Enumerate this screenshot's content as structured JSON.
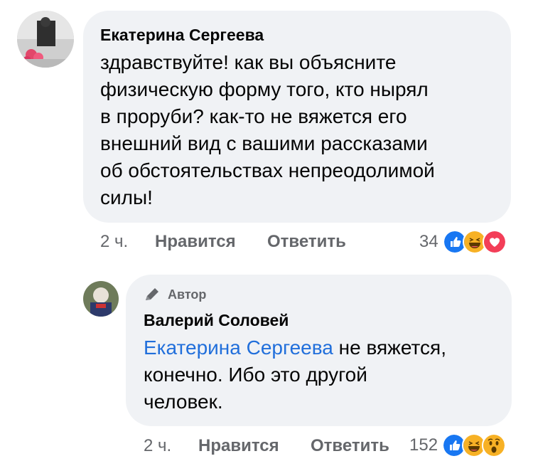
{
  "comment": {
    "author": "Екатерина Сергеева",
    "text_lines": [
      "здравствуйте! как вы объясните",
      "физическую форму того, кто нырял",
      "в проруби? как-то не вяжется его",
      "внешний вид с вашими рассказами",
      "об обстоятельствах непреодолимой",
      "силы!"
    ],
    "time": "2 ч.",
    "like_label": "Нравится",
    "reply_label": "Ответить",
    "reaction_count": "34",
    "reactions": [
      "like-icon",
      "haha-icon",
      "love-icon"
    ]
  },
  "reply": {
    "badge": "Автор",
    "author": "Валерий Соловей",
    "mention": "Екатерина Сергеева",
    "text_first": " не вяжется,",
    "text_lines": [
      "конечно. Ибо это другой",
      "человек."
    ],
    "time": "2 ч.",
    "like_label": "Нравится",
    "reply_label": "Ответить",
    "reaction_count": "152",
    "reactions": [
      "like-icon",
      "haha-icon",
      "wow-icon"
    ]
  },
  "colors": {
    "bubble": "#f0f2f5",
    "meta": "#65676b",
    "mention": "#216fdb",
    "like": "#1877f2",
    "haha": "#f7b125",
    "love": "#f33e58"
  }
}
